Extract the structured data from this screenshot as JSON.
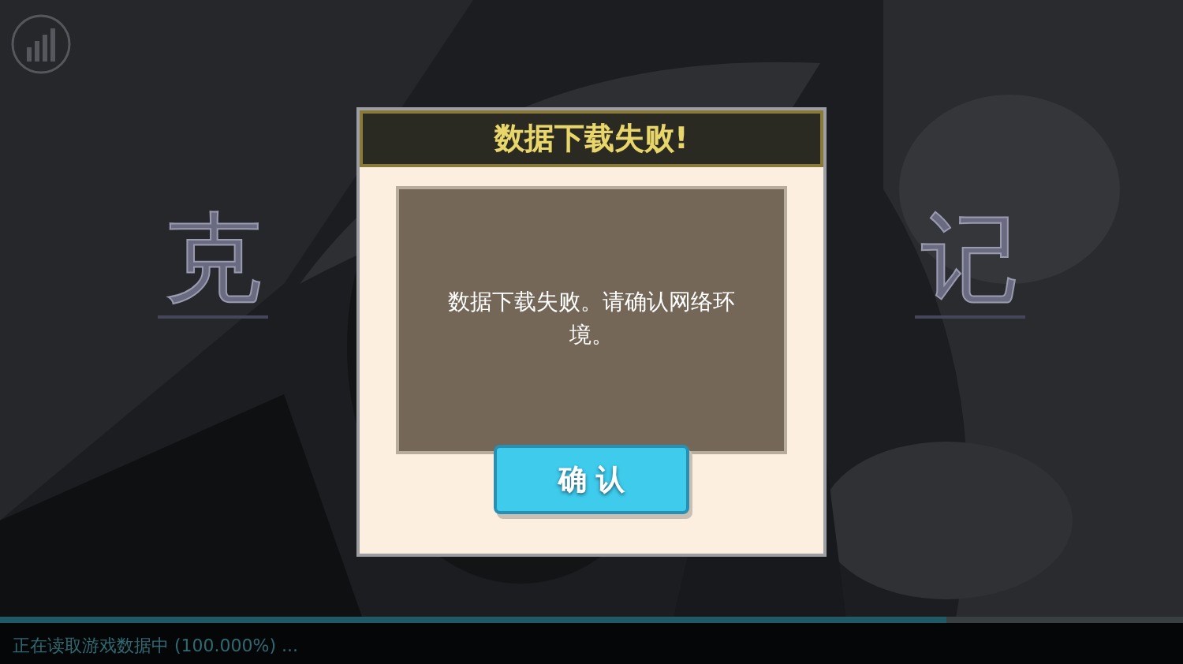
{
  "logo": {
    "left": "克",
    "right": "记"
  },
  "dialog": {
    "title": "数据下载失败!",
    "message": "数据下载失败。请确认网络环境。",
    "button": "确 认"
  },
  "loading": {
    "level": 0.8,
    "text": "正在读取游戏数据中 (100.000%) ..."
  }
}
